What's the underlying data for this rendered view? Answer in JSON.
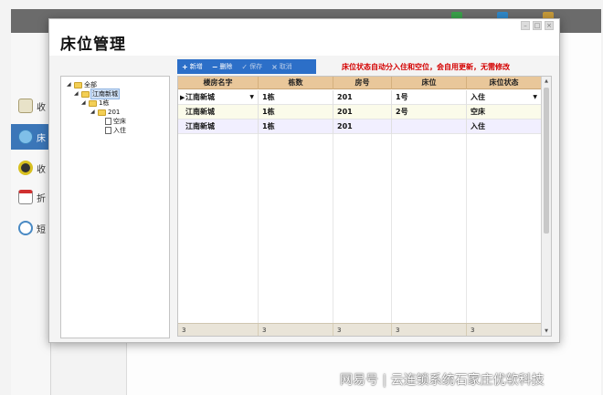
{
  "background_app": {
    "header_buttons": [
      "",
      "",
      ""
    ],
    "nav_items": [
      {
        "label": "收",
        "icon": "document-icon"
      },
      {
        "label": "床",
        "icon": "globe-icon"
      },
      {
        "label": "收",
        "icon": "disc-icon"
      },
      {
        "label": "折",
        "icon": "pencil-icon"
      },
      {
        "label": "短",
        "icon": "magnifier-icon"
      }
    ]
  },
  "dialog": {
    "title": "床位管理",
    "toolbar": {
      "add_label": "新增",
      "delete_label": "删除",
      "save_label": "保存",
      "cancel_label": "取消"
    },
    "notice": "床位状态自动分入住和空位，会自用更新，无需修改"
  },
  "tree": {
    "root": "全部",
    "building": "江南新城",
    "block": "1栋",
    "room": "201",
    "leaves": [
      "空床",
      "入住"
    ]
  },
  "grid": {
    "columns": [
      "楼房名字",
      "栋数",
      "房号",
      "床位",
      "床位状态"
    ],
    "rows": [
      [
        "江南新城",
        "1栋",
        "201",
        "1号",
        "入住"
      ],
      [
        "江南新城",
        "1栋",
        "201",
        "2号",
        "空床"
      ],
      [
        "江南新城",
        "1栋",
        "201",
        "",
        "入住"
      ]
    ],
    "footer": [
      "3",
      "3",
      "3",
      "3",
      "3"
    ]
  },
  "watermark": "网易号 | 云连锁系统石家庄优软科技"
}
